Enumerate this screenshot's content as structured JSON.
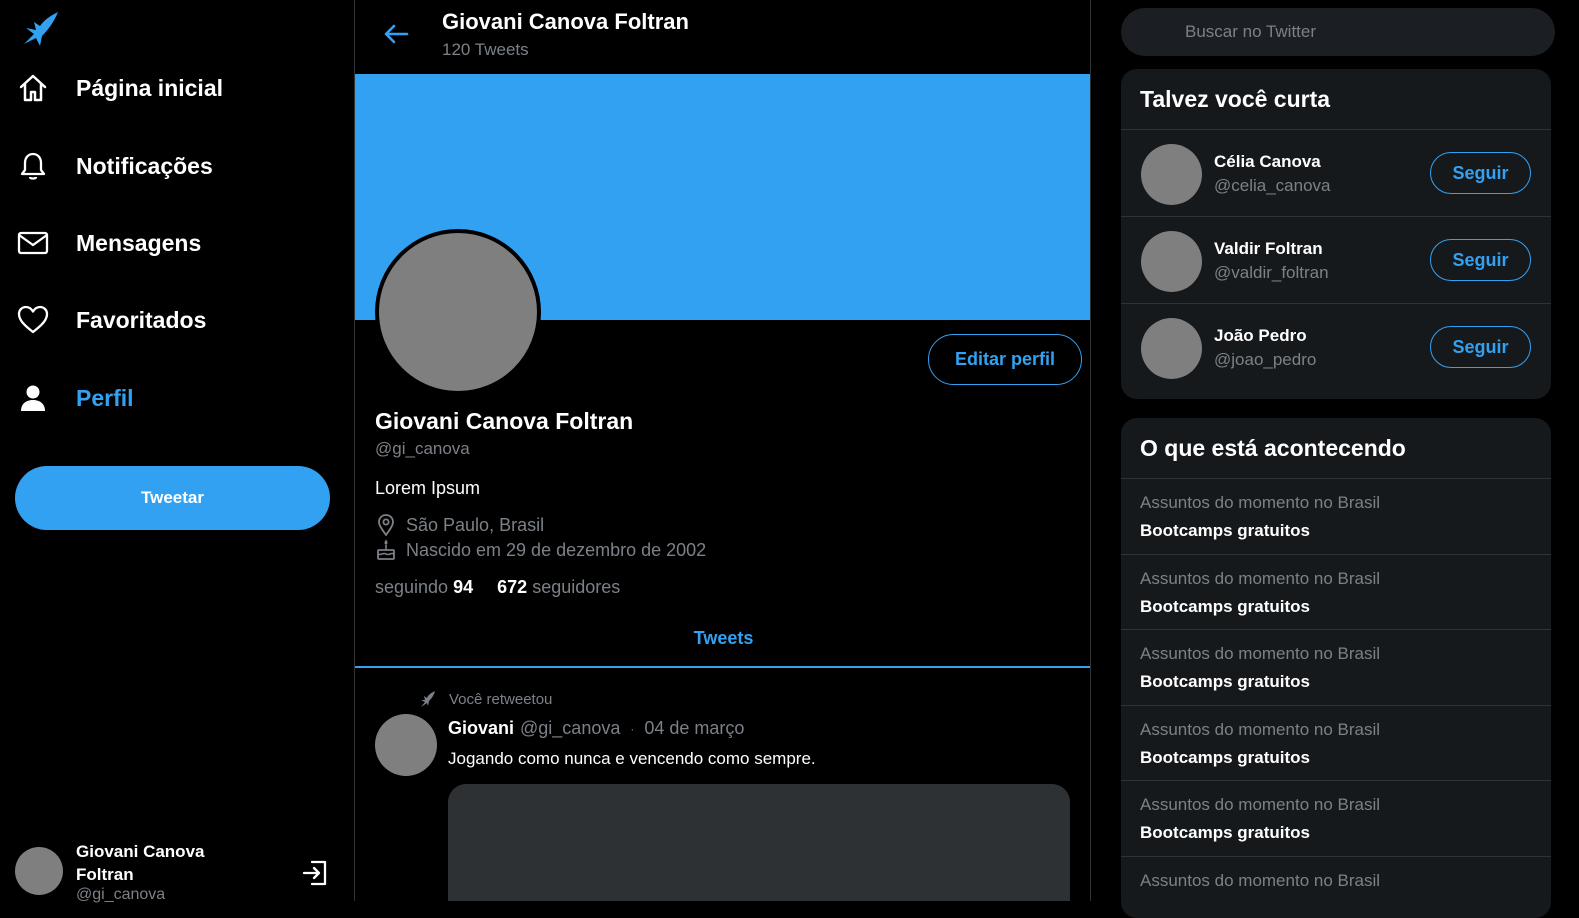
{
  "nav": {
    "items": [
      {
        "label": "Página inicial",
        "icon": "home-icon"
      },
      {
        "label": "Notificações",
        "icon": "bell-icon"
      },
      {
        "label": "Mensagens",
        "icon": "mail-icon"
      },
      {
        "label": "Favoritados",
        "icon": "heart-icon"
      },
      {
        "label": "Perfil",
        "icon": "person-icon",
        "active": true
      }
    ],
    "tweet_button": "Tweetar"
  },
  "account": {
    "name": "Giovani Canova Foltran",
    "handle": "@gi_canova"
  },
  "header": {
    "name": "Giovani Canova Foltran",
    "tweet_count": "120 Tweets"
  },
  "profile": {
    "edit_button": "Editar perfil",
    "name": "Giovani Canova Foltran",
    "handle": "@gi_canova",
    "bio": "Lorem Ipsum",
    "location": "São Paulo, Brasil",
    "birth": "Nascido em 29 de dezembro de 2002",
    "following_label": "seguindo",
    "following_count": "94",
    "followers_count": "672",
    "followers_label": "seguidores"
  },
  "tabs": {
    "tweets": "Tweets"
  },
  "tweet": {
    "retweet_label": "Você retweetou",
    "name": "Giovani",
    "handle": "@gi_canova",
    "separator": "·",
    "date": "04 de março",
    "text": "Jogando como nunca e vencendo como sempre."
  },
  "search": {
    "placeholder": "Buscar no Twitter"
  },
  "who_to_follow": {
    "title": "Talvez você curta",
    "users": [
      {
        "name": "Célia Canova",
        "handle": "@celia_canova",
        "button": "Seguir"
      },
      {
        "name": "Valdir Foltran",
        "handle": "@valdir_foltran",
        "button": "Seguir"
      },
      {
        "name": "João Pedro",
        "handle": "@joao_pedro",
        "button": "Seguir"
      }
    ]
  },
  "trends": {
    "title": "O que está acontecendo",
    "items": [
      {
        "context": "Assuntos do momento no Brasil",
        "topic": "Bootcamps gratuitos"
      },
      {
        "context": "Assuntos do momento no Brasil",
        "topic": "Bootcamps gratuitos"
      },
      {
        "context": "Assuntos do momento no Brasil",
        "topic": "Bootcamps gratuitos"
      },
      {
        "context": "Assuntos do momento no Brasil",
        "topic": "Bootcamps gratuitos"
      },
      {
        "context": "Assuntos do momento no Brasil",
        "topic": "Bootcamps gratuitos"
      },
      {
        "context": "Assuntos do momento no Brasil",
        "topic": ""
      }
    ]
  },
  "colors": {
    "accent": "#33a1f2",
    "background": "#000000",
    "panel": "#16191c",
    "muted_text": "#7b8187"
  }
}
